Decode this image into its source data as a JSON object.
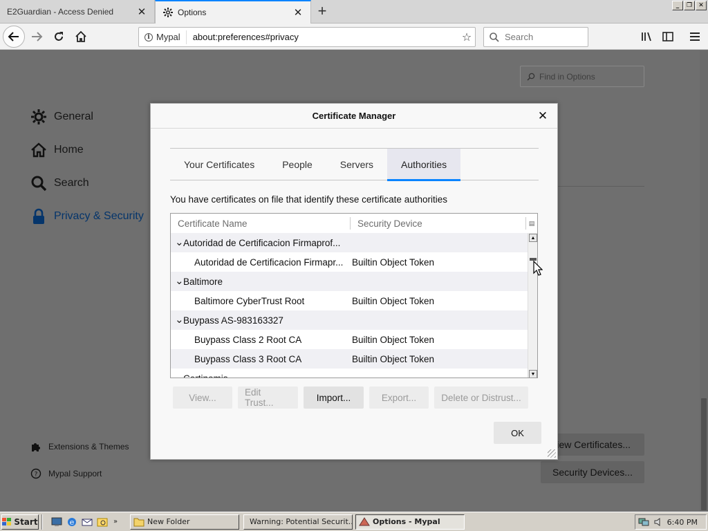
{
  "browser": {
    "tabs": [
      {
        "title": "E2Guardian - Access Denied",
        "active": false
      },
      {
        "title": "Options",
        "active": true
      }
    ],
    "identity_label": "Mypal",
    "url": "about:preferences#privacy",
    "search_placeholder": "Search"
  },
  "preferences": {
    "find_placeholder": "Find in Options",
    "categories": [
      {
        "label": "General",
        "icon": "gear-icon"
      },
      {
        "label": "Home",
        "icon": "home-icon"
      },
      {
        "label": "Search",
        "icon": "search-icon"
      },
      {
        "label": "Privacy & Security",
        "icon": "lock-icon",
        "active": true
      }
    ],
    "footer_links": [
      {
        "label": "Extensions & Themes",
        "icon": "puzzle-icon"
      },
      {
        "label": "Mypal Support",
        "icon": "help-icon"
      }
    ],
    "view_certificates_label": "View Certificates...",
    "security_devices_label": "Security Devices..."
  },
  "dialog": {
    "title": "Certificate Manager",
    "tabs": [
      "Your Certificates",
      "People",
      "Servers",
      "Authorities"
    ],
    "active_tab": "Authorities",
    "description": "You have certificates on file that identify these certificate authorities",
    "columns": [
      "Certificate Name",
      "Security Device"
    ],
    "rows": [
      {
        "type": "group",
        "name": "Autoridad de Certificacion Firmaprof...",
        "device": ""
      },
      {
        "type": "child",
        "name": "Autoridad de Certificacion Firmapr...",
        "device": "Builtin Object Token"
      },
      {
        "type": "group",
        "name": "Baltimore",
        "device": ""
      },
      {
        "type": "child",
        "name": "Baltimore CyberTrust Root",
        "device": "Builtin Object Token"
      },
      {
        "type": "group",
        "name": "Buypass AS-983163327",
        "device": ""
      },
      {
        "type": "child",
        "name": "Buypass Class 2 Root CA",
        "device": "Builtin Object Token"
      },
      {
        "type": "child",
        "name": "Buypass Class 3 Root CA",
        "device": "Builtin Object Token"
      },
      {
        "type": "group",
        "name": "Certinomis",
        "device": ""
      }
    ],
    "buttons": {
      "view": "View...",
      "edit_trust": "Edit Trust...",
      "import": "Import...",
      "export": "Export...",
      "delete": "Delete or Distrust..."
    },
    "ok_label": "OK"
  },
  "taskbar": {
    "start_label": "Start",
    "tasks": [
      {
        "label": "New Folder"
      },
      {
        "label": "Warning: Potential Securit..."
      },
      {
        "label": "Options - Mypal",
        "active": true
      }
    ],
    "clock": "6:40 PM"
  },
  "colors": {
    "accent": "#0a84ff",
    "dim_overlay": "#6f6f6f",
    "taskbar": "#d4d0c8"
  }
}
